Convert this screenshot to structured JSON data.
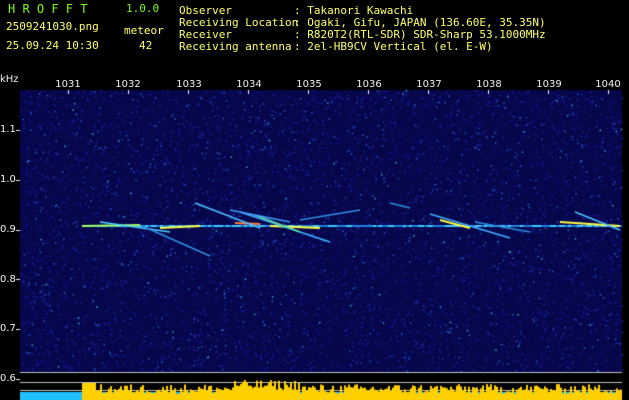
{
  "header": {
    "app_name": "H R O F F T",
    "version": "1.0.0",
    "filename": "2509241030.png",
    "datetime": "25.09.24 10:30",
    "meteor_label": "meteor",
    "meteor_count": "42"
  },
  "info": {
    "labels": [
      "Observer",
      "Receiving Location",
      "Receiver",
      "Receiving antenna"
    ],
    "values": [
      ": Takanori Kawachi",
      ": Ogaki, Gifu, JAPAN (136.60E, 35.35N)",
      ": R820T2(RTL-SDR) SDR-Sharp 53.1000MHz",
      ": 2el-HB9CV Vertical (el. E-W)"
    ]
  },
  "axes": {
    "y_unit": "kHz",
    "y_ticks": [
      "1.1",
      "1.0",
      "0.9",
      "0.8",
      "0.7",
      "0.6"
    ],
    "x_ticks": [
      "1031",
      "1032",
      "1033",
      "1034",
      "1035",
      "1036",
      "1037",
      "1038",
      "1039",
      "1040"
    ]
  },
  "colors": {
    "background": "#000000",
    "noise": "#0a0a6a",
    "signal": "#ffff40",
    "carrier": "#40c0ff",
    "power_bar": "#ffd000",
    "power_base": "#20c0ff"
  }
}
